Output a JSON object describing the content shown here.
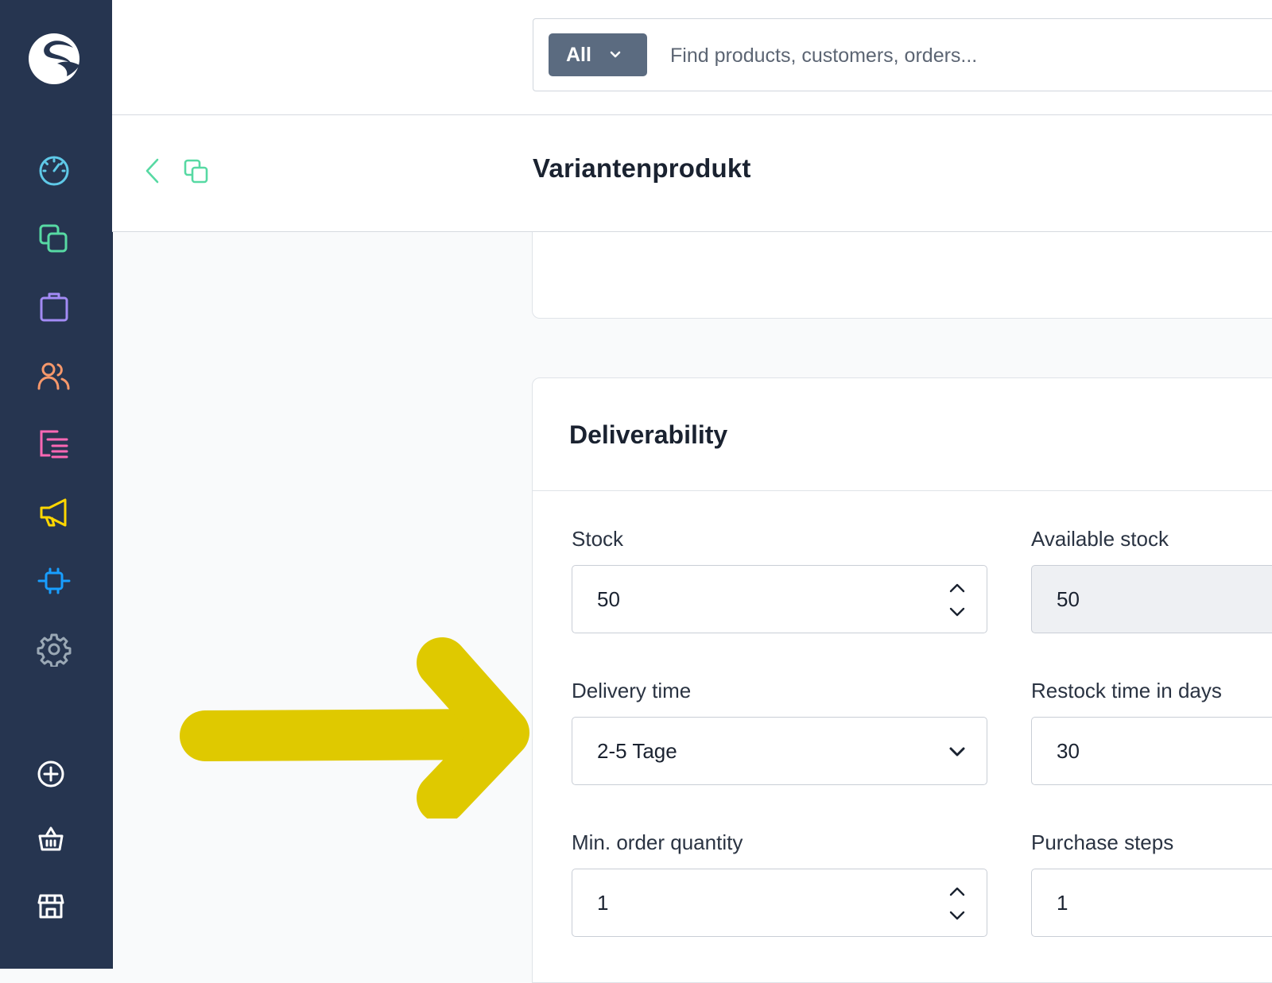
{
  "search": {
    "type_label": "All",
    "placeholder": "Find products, customers, orders..."
  },
  "header": {
    "title": "Variantenprodukt"
  },
  "sidebar": {
    "items": [
      {
        "name": "dashboard-icon",
        "color": "#5fc9e8"
      },
      {
        "name": "catalogues-icon",
        "color": "#57d9a3"
      },
      {
        "name": "orders-icon",
        "color": "#a38bf5"
      },
      {
        "name": "customers-icon",
        "color": "#f7986b"
      },
      {
        "name": "content-icon",
        "color": "#ff68b4"
      },
      {
        "name": "marketing-icon",
        "color": "#ffd700"
      },
      {
        "name": "extensions-icon",
        "color": "#189eff"
      },
      {
        "name": "settings-icon",
        "color": "#9aa8b5"
      }
    ],
    "utilities": [
      "add-icon",
      "basket-icon",
      "storefront-icon"
    ]
  },
  "deliverability": {
    "title": "Deliverability",
    "stock": {
      "label": "Stock",
      "value": "50"
    },
    "available_stock": {
      "label": "Available stock",
      "value": "50"
    },
    "delivery_time": {
      "label": "Delivery time",
      "value": "2-5 Tage"
    },
    "restock_time": {
      "label": "Restock time in days",
      "value": "30"
    },
    "min_order_quantity": {
      "label": "Min. order quantity",
      "value": "1"
    },
    "purchase_steps": {
      "label": "Purchase steps",
      "value": "1"
    }
  },
  "colors": {
    "sidebar_bg": "#263550",
    "accent_green": "#57d9a3",
    "annotation_arrow": "#dfc900"
  }
}
